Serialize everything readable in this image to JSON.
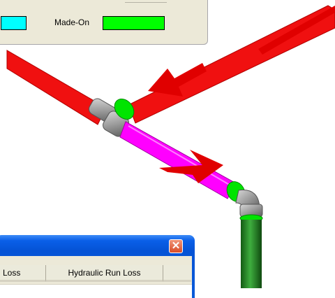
{
  "legend": {
    "made_on_label": "Made-On",
    "swatch_colors": {
      "left": "#00ffff",
      "made_on": "#00ff00"
    }
  },
  "dialog": {
    "close_icon": "close-icon",
    "close_glyph": "✕",
    "columns": [
      "Loss",
      "Hydraulic Run Loss"
    ]
  },
  "scene": {
    "pipe_color": "#ff1010",
    "selected_pipe_color": "#ff00ff",
    "fitting_color": "#999999",
    "made_on_color": "#00ff00",
    "drop_color": "#1f7a1f"
  }
}
